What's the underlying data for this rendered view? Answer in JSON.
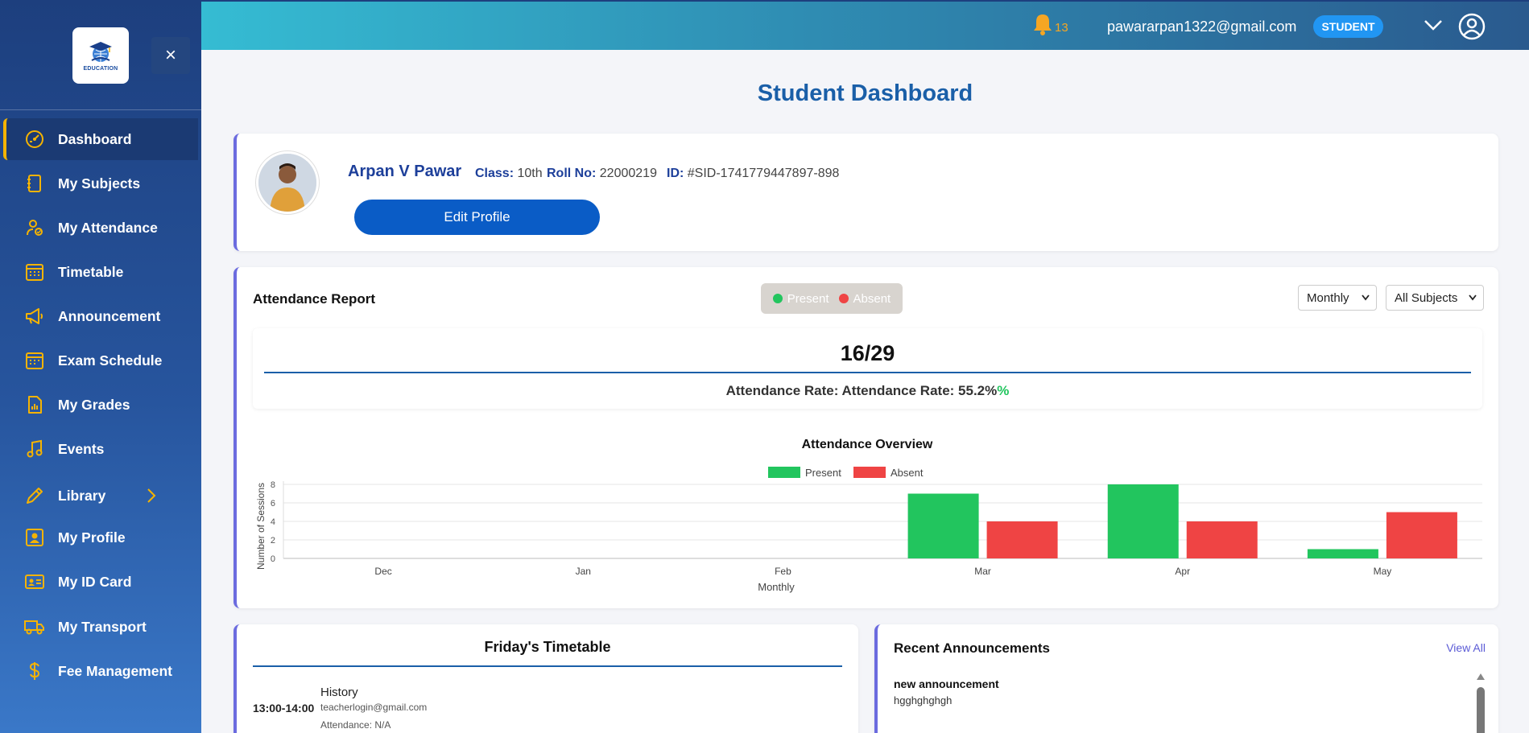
{
  "sidebar": {
    "logo_text": "EDUCATION",
    "close_label": "×",
    "items": [
      {
        "label": "Dashboard",
        "icon": "dashboard-gauge-icon",
        "active": true
      },
      {
        "label": "My Subjects",
        "icon": "notebook-icon"
      },
      {
        "label": "My Attendance",
        "icon": "user-check-icon"
      },
      {
        "label": "Timetable",
        "icon": "calendar-grid-icon"
      },
      {
        "label": "Announcement",
        "icon": "megaphone-icon"
      },
      {
        "label": "Exam Schedule",
        "icon": "calendar-icon"
      },
      {
        "label": "My Grades",
        "icon": "report-chart-icon"
      },
      {
        "label": "Events",
        "icon": "music-note-icon"
      },
      {
        "label": "Library",
        "icon": "pencil-icon",
        "has_submenu": true
      },
      {
        "label": "My Profile",
        "icon": "profile-icon"
      },
      {
        "label": "My ID Card",
        "icon": "id-card-icon"
      },
      {
        "label": "My Transport",
        "icon": "truck-icon"
      },
      {
        "label": "Fee Management",
        "icon": "dollar-icon"
      }
    ]
  },
  "header": {
    "notification_count": "13",
    "email": "pawararpan1322@gmail.com",
    "role": "STUDENT"
  },
  "page_title": "Student Dashboard",
  "profile": {
    "name": "Arpan V Pawar",
    "class_label": "Class:",
    "class_value": "10th",
    "roll_label": "Roll No:",
    "roll_value": "22000219",
    "id_label": "ID:",
    "id_value": "#SID-1741779447897-898",
    "edit_button": "Edit Profile"
  },
  "attendance": {
    "title": "Attendance Report",
    "legend_present": "Present",
    "legend_absent": "Absent",
    "period_select": "Monthly",
    "subject_select": "All Subjects",
    "ratio": "16/29",
    "rate_label": "Attendance Rate: Attendance Rate:",
    "rate_value": "55.2%",
    "rate_suffix": "%",
    "colors": {
      "present": "#22c55e",
      "absent": "#ef4444"
    }
  },
  "chart_data": {
    "type": "bar",
    "title": "Attendance Overview",
    "xlabel": "Monthly",
    "ylabel": "Number of Sessions",
    "categories": [
      "Dec",
      "Jan",
      "Feb",
      "Mar",
      "Apr",
      "May"
    ],
    "series": [
      {
        "name": "Present",
        "values": [
          0,
          0,
          0,
          7,
          8,
          1
        ],
        "color": "#22c55e"
      },
      {
        "name": "Absent",
        "values": [
          0,
          0,
          0,
          4,
          4,
          5
        ],
        "color": "#ef4444"
      }
    ],
    "ylim": [
      0,
      8
    ],
    "yticks": [
      0,
      2,
      4,
      6,
      8
    ],
    "legend": "top-center",
    "grid": true
  },
  "timetable": {
    "title": "Friday's Timetable",
    "time": "13:00-14:00",
    "subject": "History",
    "teacher": "teacherlogin@gmail.com",
    "attendance": "Attendance: N/A"
  },
  "announcements": {
    "title": "Recent Announcements",
    "view_all": "View All",
    "item_title": "new announcement",
    "item_body": "hgghghghgh"
  }
}
